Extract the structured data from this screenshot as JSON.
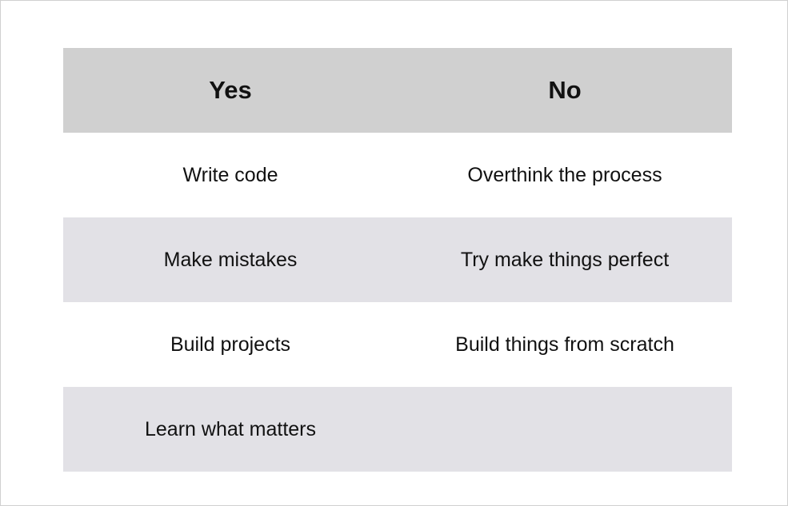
{
  "header": {
    "yes": "Yes",
    "no": "No"
  },
  "rows": [
    {
      "yes": "Write code",
      "no": "Overthink the process"
    },
    {
      "yes": "Make mistakes",
      "no": "Try make things perfect"
    },
    {
      "yes": "Build projects",
      "no": "Build things from scratch"
    },
    {
      "yes": "Learn what matters",
      "no": ""
    }
  ],
  "colors": {
    "header_bg": "#d0d0d0",
    "shaded_row_bg": "#e2e1e6",
    "plain_row_bg": "#ffffff",
    "text": "#111111"
  }
}
